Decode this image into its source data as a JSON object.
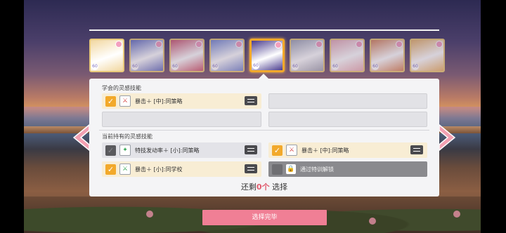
{
  "panel": {
    "learned_label": "学会的灵感技能",
    "owned_label": "当前持有的灵感技能"
  },
  "learned_skills": [
    {
      "text": "暴击＋ [中]:同策略",
      "checked": true
    },
    {
      "text": "",
      "checked": false
    },
    {
      "text": "",
      "checked": false
    },
    {
      "text": "",
      "checked": false
    }
  ],
  "owned_skills": [
    {
      "text": "特技发动率＋ [小]:同策略",
      "checked": false
    },
    {
      "text": "暴击＋ [中]:同策略",
      "checked": true
    },
    {
      "text": "暴击＋ [小]:同学校",
      "checked": true
    },
    {
      "text": "通过特训解锁",
      "checked": false
    }
  ],
  "remaining": {
    "prefix": "还剩",
    "count": "0",
    "unit": "个",
    "suffix": " 选择"
  },
  "buttons": {
    "done": "选择完毕"
  },
  "cards": [
    {
      "color": "#f2d79f",
      "level": "60"
    },
    {
      "color": "#6e78c2",
      "level": "60"
    },
    {
      "color": "#cf5f74",
      "level": "60"
    },
    {
      "color": "#7f8fd1",
      "level": "60"
    },
    {
      "color": "#4b3d8f",
      "level": "60"
    },
    {
      "color": "#a7a9b8",
      "level": "60"
    },
    {
      "color": "#e9b0b9",
      "level": "60"
    },
    {
      "color": "#d88a62",
      "level": "60"
    },
    {
      "color": "#e8b46e",
      "level": "60"
    }
  ],
  "colors": {
    "accent": "#f2a92b",
    "button": "#f07f95",
    "count": "#e05a6d"
  }
}
